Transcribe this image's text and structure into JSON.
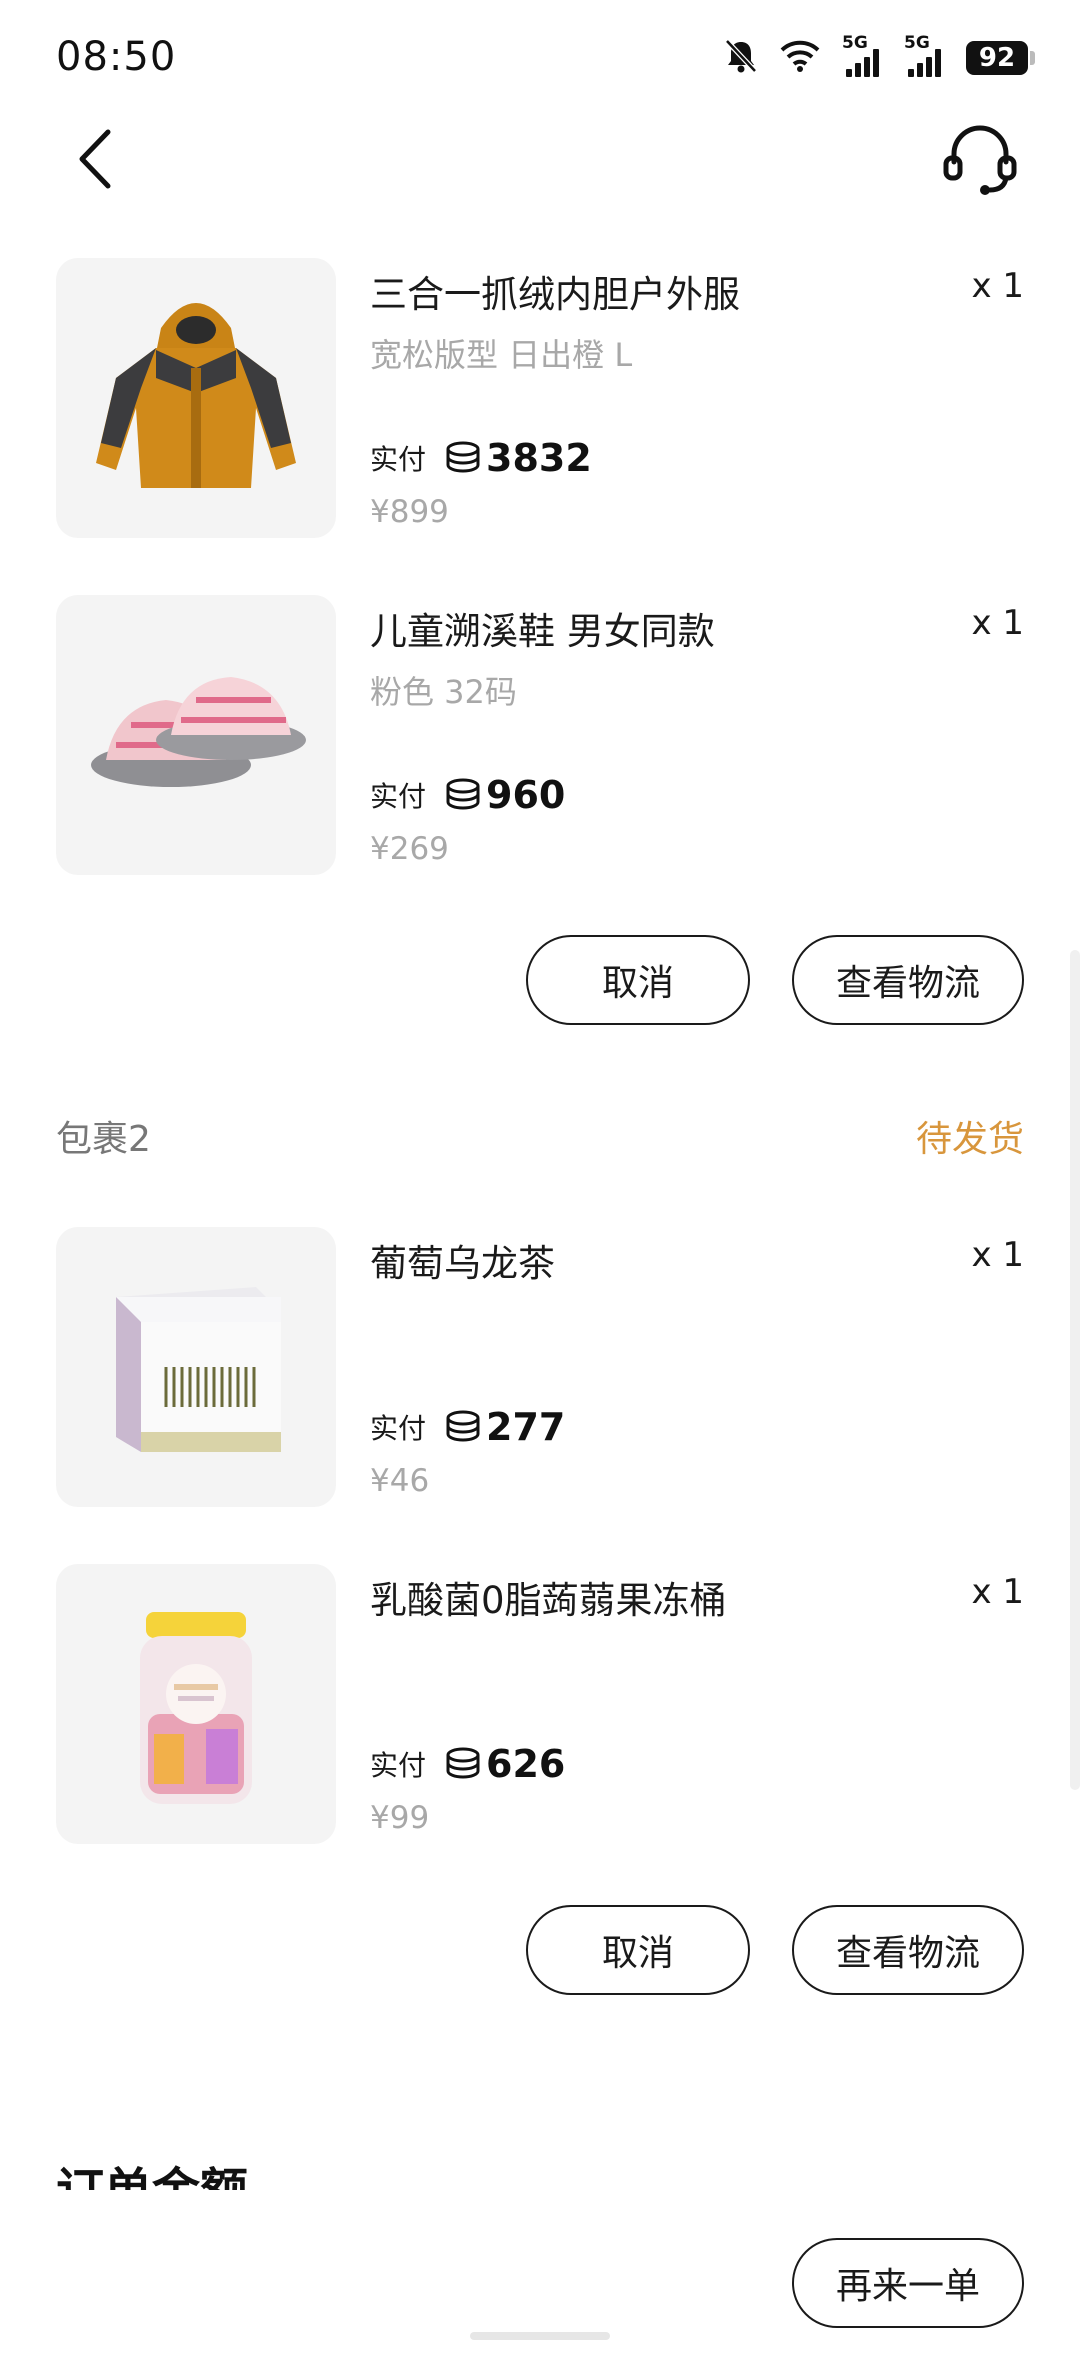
{
  "status_bar": {
    "time": "08:50",
    "network_1": "5G",
    "network_2": "5G",
    "battery": "92"
  },
  "items": [
    {
      "name": "三合一抓绒内胆户外服",
      "spec": "宽松版型 日出橙 L",
      "qty": "x 1",
      "paid_label": "实付",
      "paid": "3832",
      "price": "¥899",
      "icon": "jacket"
    },
    {
      "name": "儿童溯溪鞋 男女同款",
      "spec": "粉色 32码",
      "qty": "x 1",
      "paid_label": "实付",
      "paid": "960",
      "price": "¥269",
      "icon": "sandals"
    },
    {
      "name": "葡萄乌龙茶",
      "spec": "",
      "qty": "x 1",
      "paid_label": "实付",
      "paid": "277",
      "price": "¥46",
      "icon": "tea-box"
    },
    {
      "name": "乳酸菌0脂蒟蒻果冻桶",
      "spec": "",
      "qty": "x 1",
      "paid_label": "实付",
      "paid": "626",
      "price": "¥99",
      "icon": "jelly-bucket"
    }
  ],
  "package1": {
    "cancel_label": "取消",
    "logistics_label": "查看物流"
  },
  "package2": {
    "title": "包裹2",
    "status": "待发货",
    "cancel_label": "取消",
    "logistics_label": "查看物流"
  },
  "section_title": "订单金额",
  "footer": {
    "reorder_label": "再来一单"
  },
  "colors": {
    "status_pending": "#d8963c",
    "text_primary": "#1a1a1a",
    "text_secondary": "#a8a8a8"
  }
}
